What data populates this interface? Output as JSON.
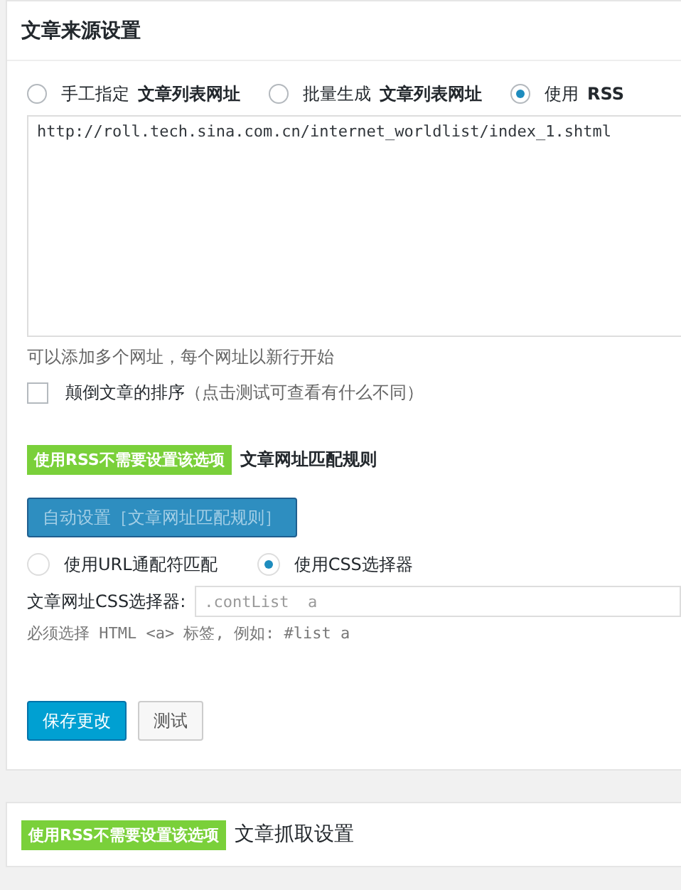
{
  "source_panel": {
    "title": "文章来源设置",
    "source_options": [
      {
        "label": "手工指定",
        "strong": "文章列表网址",
        "selected": false
      },
      {
        "label": "批量生成",
        "strong": "文章列表网址",
        "selected": false
      },
      {
        "label": "使用",
        "strong": "RSS",
        "selected": true
      }
    ],
    "urls": "http://roll.tech.sina.com.cn/internet_worldlist/index_1.shtml",
    "urls_hint": "可以添加多个网址，每个网址以新行开始",
    "reverse": {
      "label": "颠倒文章的排序",
      "note": "（点击测试可查看有什么不同）",
      "checked": false
    },
    "match_section": {
      "badge": "使用RSS不需要设置该选项",
      "title": "文章网址匹配规则",
      "disabled": true,
      "auto_button": "自动设置［文章网址匹配规则］",
      "match_modes": [
        {
          "label": "使用URL通配符匹配",
          "selected": false
        },
        {
          "label": "使用CSS选择器",
          "selected": true
        }
      ],
      "selector_label": "文章网址CSS选择器:",
      "selector_value": ".contList  a",
      "selector_hint": "必须选择 HTML <a> 标签, 例如: #list a"
    },
    "buttons": [
      {
        "label": "保存更改",
        "kind": "primary"
      },
      {
        "label": "测试",
        "kind": "secondary"
      }
    ]
  },
  "fetch_panel": {
    "badge": "使用RSS不需要设置该选项",
    "title": "文章抓取设置"
  }
}
